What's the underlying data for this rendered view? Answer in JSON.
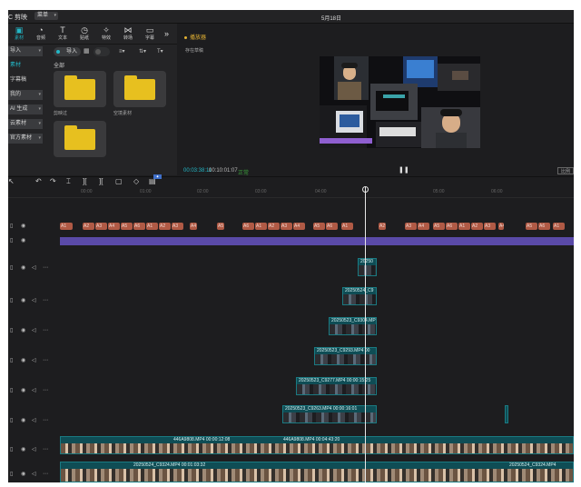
{
  "titlebar": {
    "app_name": "C 剪映",
    "menu_label": "菜单",
    "date_title": "5月18日"
  },
  "tabs": [
    {
      "label": "素材",
      "icon": "media-icon"
    },
    {
      "label": "音频",
      "icon": "audio-icon"
    },
    {
      "label": "文本",
      "icon": "text-icon"
    },
    {
      "label": "贴纸",
      "icon": "sticker-icon"
    },
    {
      "label": "特效",
      "icon": "effects-icon"
    },
    {
      "label": "转场",
      "icon": "transition-icon"
    },
    {
      "label": "字幕",
      "icon": "subtitle-icon"
    }
  ],
  "sidebar": {
    "items": [
      {
        "label": "导入"
      },
      {
        "label": "素材"
      },
      {
        "label": "字幕稿"
      },
      {
        "label": "我的"
      },
      {
        "label": "AI 生成"
      },
      {
        "label": "云素材"
      },
      {
        "label": "官方素材"
      }
    ]
  },
  "media": {
    "import_label": "导入",
    "section_label": "全部",
    "folders": [
      {
        "label": "剪映过"
      },
      {
        "label": "空境素材"
      },
      {
        "label": ""
      }
    ]
  },
  "player": {
    "title": "播放器",
    "subtitle": "存在草稿",
    "current_time": "00:03:38:11",
    "total_time": "00:10:01:07",
    "status": "正常",
    "ratio_label": "比例"
  },
  "timeline": {
    "ruler_ticks": [
      "00:00",
      "01:00",
      "02:00",
      "03:00",
      "04:00",
      "05:00",
      "06:00"
    ],
    "effect_labels": [
      "A1",
      "A2",
      "A3",
      "A4",
      "A5",
      "A6"
    ],
    "clips": [
      {
        "label": "20250"
      },
      {
        "label": "20250524_C9"
      },
      {
        "label": "20250523_C9304.MP"
      },
      {
        "label": "20250523_C9293.MP4  00"
      },
      {
        "label": "20250523_C9277.MP4  00:00:15:25"
      },
      {
        "label": "20250523_C9263.MP4  00:00:16:01"
      },
      {
        "label": "446A9808.MP4  00:00:12:08"
      },
      {
        "label": "446A9808.MP4  00:04:43:20"
      },
      {
        "label": "20250524_C9324.MP4  00:01:03:32"
      },
      {
        "label": "20250524_C9324.MP4"
      }
    ],
    "playhead_time": "00:03:38:11"
  }
}
